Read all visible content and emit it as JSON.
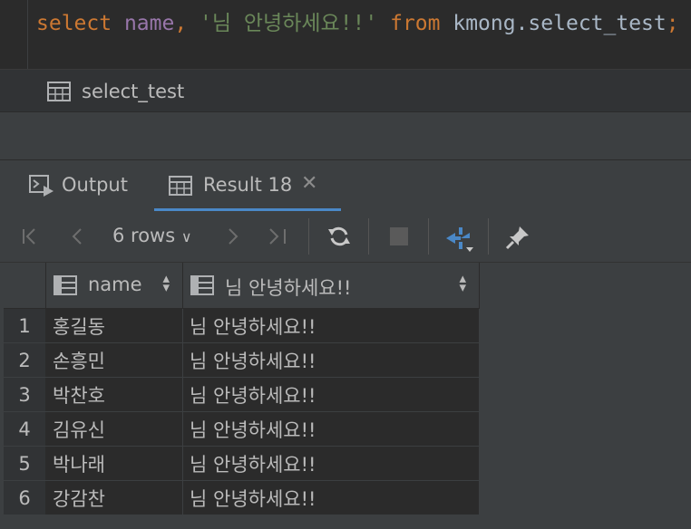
{
  "editor": {
    "sql": [
      {
        "cls": "kw",
        "text": "select"
      },
      {
        "cls": "plain",
        "text": " "
      },
      {
        "cls": "id",
        "text": "name"
      },
      {
        "cls": "kw",
        "text": ", "
      },
      {
        "cls": "str",
        "text": "'님 안녕하세요!!'"
      },
      {
        "cls": "plain",
        "text": " "
      },
      {
        "cls": "kw",
        "text": "from"
      },
      {
        "cls": "plain",
        "text": " kmong.select_test"
      },
      {
        "cls": "kw",
        "text": ";"
      }
    ]
  },
  "breadcrumb": {
    "label": "select_test",
    "icon": "table-icon"
  },
  "tabs": [
    {
      "label": "Output",
      "icon": "output-icon",
      "active": false
    },
    {
      "label": "Result 18",
      "icon": "table-icon",
      "active": true,
      "closable": true
    }
  ],
  "toolbar": {
    "rows_label": "6 rows",
    "buttons": [
      "first-page-icon",
      "prev-page-icon",
      "next-page-icon",
      "last-page-icon",
      "reload-icon",
      "stop-icon",
      "compare-icon",
      "pin-icon"
    ],
    "accent": "#4a88c7"
  },
  "grid": {
    "columns": [
      "name",
      "님 안녕하세요!!"
    ],
    "rows": [
      {
        "num": "1",
        "name": "홍길동",
        "greeting": "님 안녕하세요!!"
      },
      {
        "num": "2",
        "name": "손흥민",
        "greeting": "님 안녕하세요!!"
      },
      {
        "num": "3",
        "name": "박찬호",
        "greeting": "님 안녕하세요!!"
      },
      {
        "num": "4",
        "name": "김유신",
        "greeting": "님 안녕하세요!!"
      },
      {
        "num": "5",
        "name": "박나래",
        "greeting": "님 안녕하세요!!"
      },
      {
        "num": "6",
        "name": "강감찬",
        "greeting": "님 안녕하세요!!"
      }
    ]
  }
}
